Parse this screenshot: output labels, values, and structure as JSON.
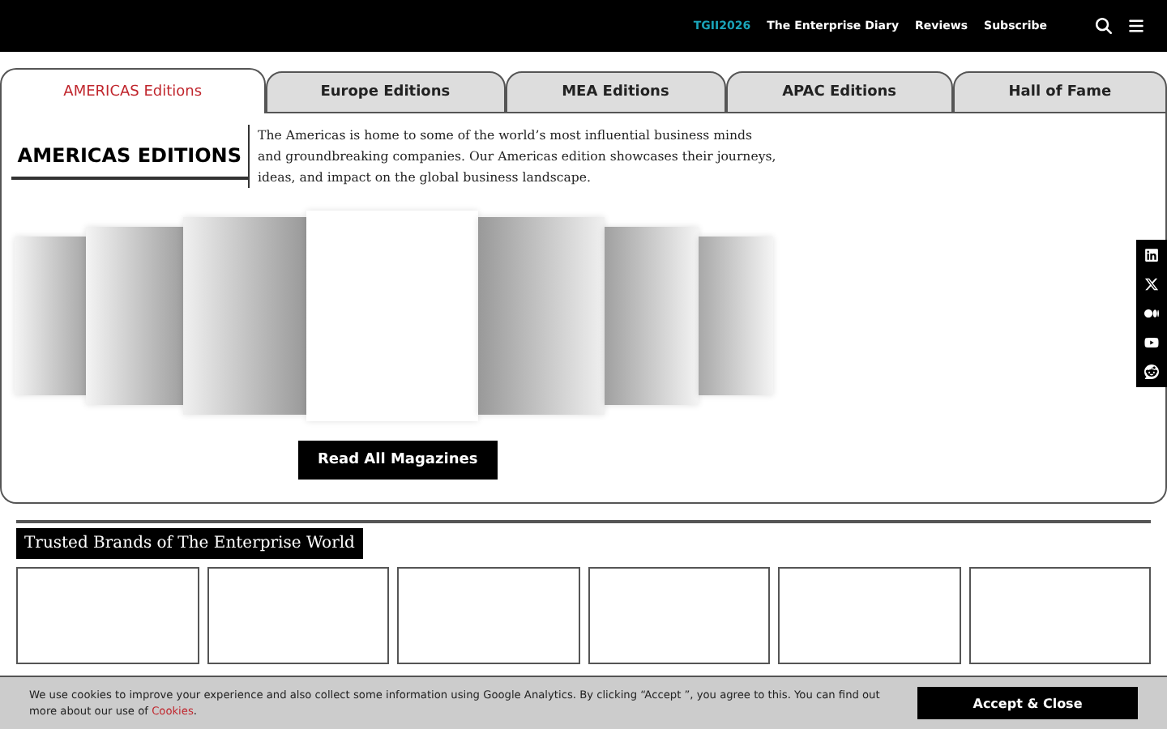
{
  "header": {
    "nav": [
      {
        "label": "TGII2026",
        "highlight": true
      },
      {
        "label": "The Enterprise Diary",
        "highlight": false
      },
      {
        "label": "Reviews",
        "highlight": false
      },
      {
        "label": "Subscribe",
        "highlight": false
      }
    ]
  },
  "tabs": [
    {
      "label": "AMERICAS Editions",
      "selected": true
    },
    {
      "label": "Europe Editions",
      "selected": false
    },
    {
      "label": "MEA Editions",
      "selected": false
    },
    {
      "label": "APAC Editions",
      "selected": false
    },
    {
      "label": "Hall of Fame",
      "selected": false
    }
  ],
  "edition": {
    "heading": "AMERICAS EDITIONS",
    "description": "The Americas is home to some of the world’s most influential business minds and groundbreaking companies. Our Americas edition showcases their journeys, ideas, and impact on the global business landscape.",
    "button": "Read All Magazines"
  },
  "brands": {
    "title": "Trusted Brands of The Enterprise World"
  },
  "cookie": {
    "text": "We use cookies to improve your experience and also collect some information using Google Analytics. By clicking “Accept ”, you agree to this. You can find out more about our use of",
    "link": "Cookies",
    "after": ".",
    "button": "Accept & Close"
  }
}
